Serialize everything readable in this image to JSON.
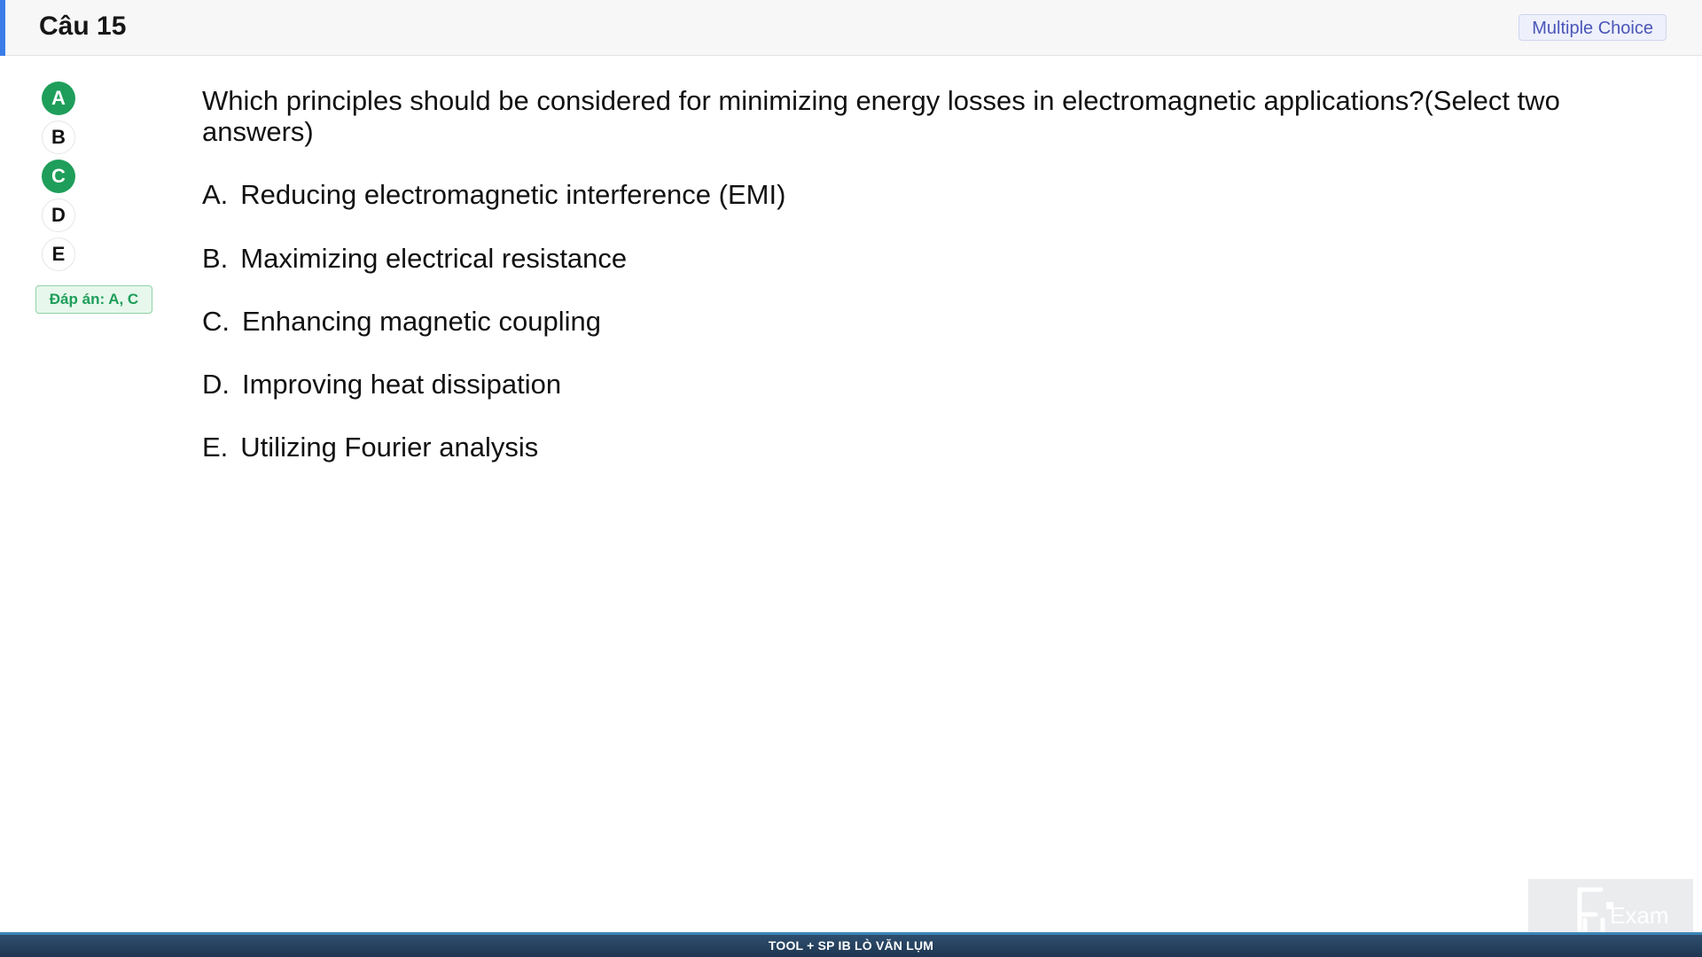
{
  "header": {
    "title": "Câu 15",
    "question_type": "Multiple Choice"
  },
  "answer_indicators": [
    {
      "letter": "A",
      "selected": true
    },
    {
      "letter": "B",
      "selected": false
    },
    {
      "letter": "C",
      "selected": true
    },
    {
      "letter": "D",
      "selected": false
    },
    {
      "letter": "E",
      "selected": false
    }
  ],
  "answer_key": "Đáp án: A, C",
  "question": {
    "text": "Which principles should be considered for minimizing energy losses in electromagnetic applications?(Select two answers)",
    "choices": [
      {
        "letter": "A.",
        "text": "Reducing electromagnetic interference (EMI)"
      },
      {
        "letter": "B.",
        "text": "Maximizing electrical resistance"
      },
      {
        "letter": "C.",
        "text": "Enhancing magnetic coupling"
      },
      {
        "letter": "D.",
        "text": "Improving heat dissipation"
      },
      {
        "letter": "E.",
        "text": "Utilizing Fourier analysis"
      }
    ]
  },
  "footer": {
    "text": "TOOL + SP IB LÒ VĂN LỤM"
  },
  "logo": {
    "label": "Exam",
    "icon": "fu-exam-logo-icon"
  },
  "colors": {
    "accent": "#3b7de8",
    "correct": "#1e9e5a",
    "badge_text": "#4a56b8",
    "footer_bg": "#1d3550"
  }
}
